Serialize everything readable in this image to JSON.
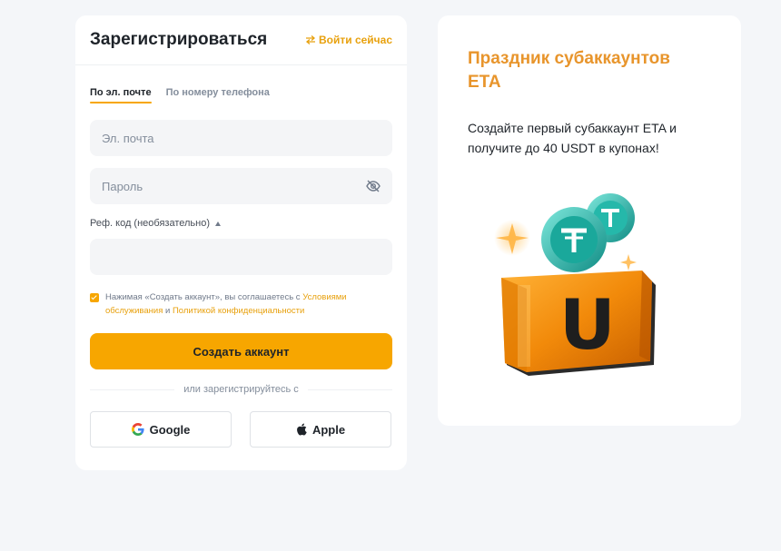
{
  "register": {
    "title": "Зарегистрироваться",
    "login_link": "Войти сейчас",
    "tabs": [
      {
        "label": "По эл. почте",
        "active": true
      },
      {
        "label": "По номеру телефона",
        "active": false
      }
    ],
    "email_placeholder": "Эл. почта",
    "password_placeholder": "Пароль",
    "ref_label": "Реф. код (необязательно)",
    "ref_value": "",
    "terms": {
      "checked": true,
      "prefix": "Нажимая «Создать аккаунт», вы соглашаетесь с ",
      "link1": "Условиями обслуживания",
      "middle": " и ",
      "link2": "Политикой конфиденциальности"
    },
    "create_button": "Создать аккаунт",
    "divider_text": "или зарегистрируйтесь с",
    "social": [
      {
        "label": "Google",
        "icon": "google-icon"
      },
      {
        "label": "Apple",
        "icon": "apple-icon"
      }
    ]
  },
  "promo": {
    "title": "Праздник субаккаунтов ETA",
    "text": "Создайте первый субаккаунт ETA и получите до 40 USDT в купонах!",
    "art_letter": "U"
  },
  "colors": {
    "accent": "#f7a600",
    "link": "#e8a10e",
    "promo_title": "#e8952c",
    "background": "#f4f6f9",
    "coin": "#1fb6a8"
  }
}
